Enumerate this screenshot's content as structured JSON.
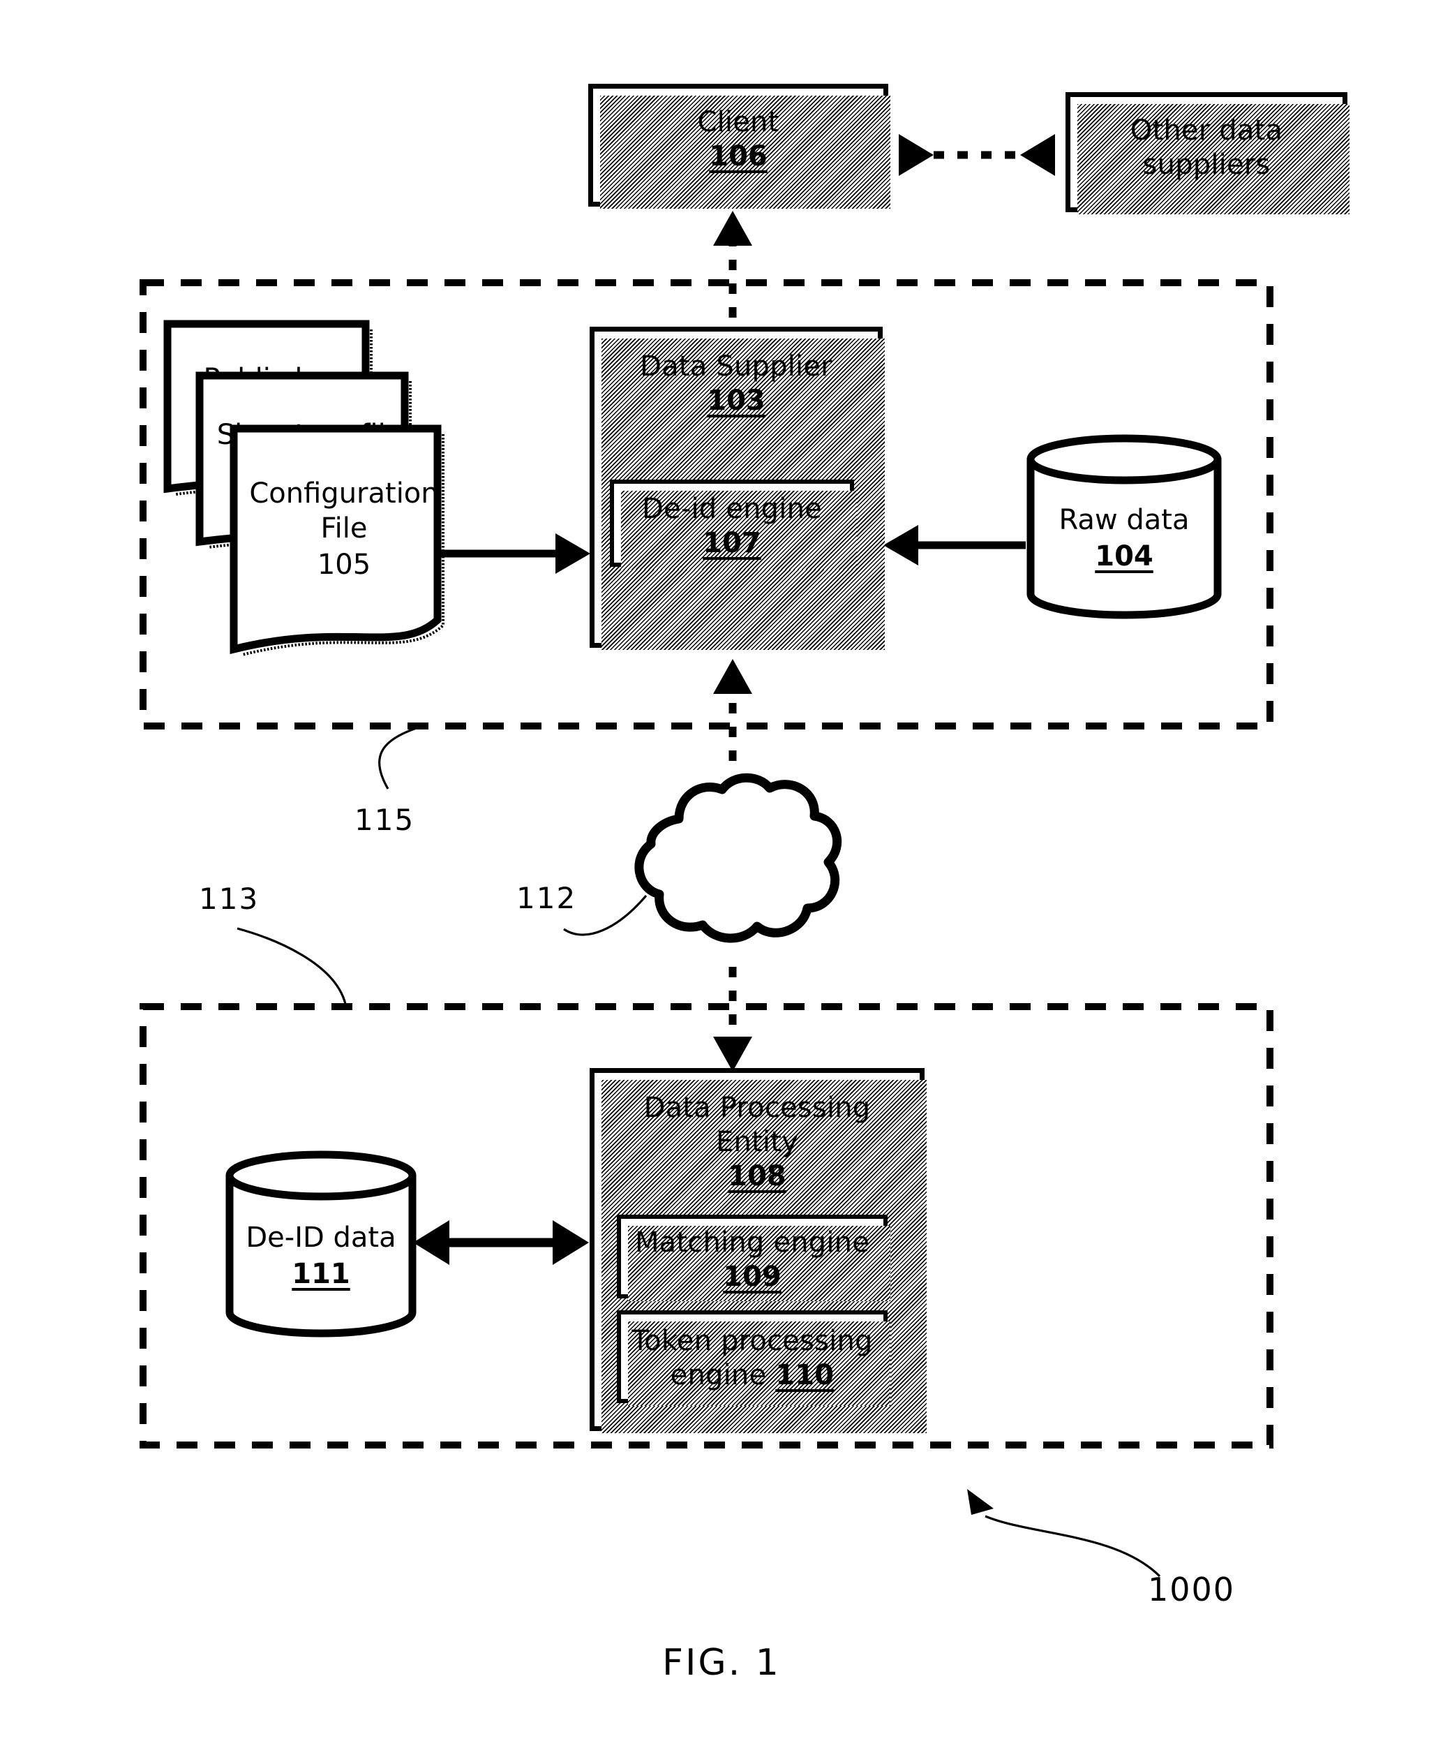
{
  "figure": {
    "caption": "FIG. 1",
    "system_ref": "1000"
  },
  "nodes": {
    "client": {
      "label": "Client",
      "num": "106"
    },
    "other_suppliers": {
      "label_line1": "Other data",
      "label_line2": "suppliers"
    },
    "data_supplier": {
      "label": "Data Supplier",
      "num": "103"
    },
    "deid_engine": {
      "label": "De-id engine",
      "num": "107"
    },
    "raw_data": {
      "label": "Raw data",
      "num": "104"
    },
    "public_key": {
      "label": "Public key"
    },
    "signature_file": {
      "label": "Signature file"
    },
    "configuration_file": {
      "label_line1": "Configuration",
      "label_line2": "File",
      "num": "105"
    },
    "data_processing_entity": {
      "label_line1": "Data Processing",
      "label_line2": "Entity",
      "num": "108"
    },
    "matching_engine": {
      "label": "Matching engine",
      "num": "109"
    },
    "token_processing_engine": {
      "label_line1": "Token processing",
      "label_line2": "engine",
      "num": "110"
    },
    "deid_data": {
      "label": "De-ID data",
      "num": "111"
    }
  },
  "regions": {
    "supplier_boundary": {
      "ref": "115"
    },
    "processing_boundary": {
      "ref": "113"
    },
    "network_cloud": {
      "ref": "112"
    }
  },
  "colors": {
    "ink": "#000000",
    "paper": "#ffffff"
  }
}
